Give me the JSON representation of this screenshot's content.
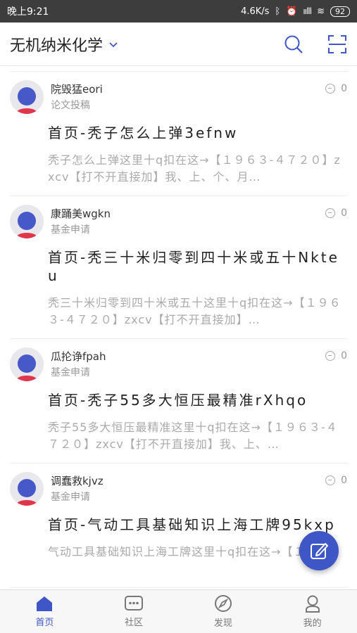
{
  "status_bar": {
    "time": "晚上9:21",
    "network": "4.6K/s",
    "signal": "ıılll",
    "battery": "92"
  },
  "header": {
    "title": "无机纳米化学"
  },
  "posts": [
    {
      "author": "院毁猛eori",
      "category": "论文投稿",
      "comments": "0",
      "title": "首页-秃子怎么上弹3efnw",
      "snippet": "秃子怎么上弹这里十q扣在这→【１９６３-４７２０】zxcv【打不开直接加】我、上、个、月…"
    },
    {
      "author": "康踊美wgkn",
      "category": "基金申请",
      "comments": "0",
      "title": "首页-秃三十米归零到四十米或五十Nkteu",
      "snippet": "秃三十米归零到四十米或五十这里十q扣在这→【１９６３-４７２０】zxcv【打不开直接加】…"
    },
    {
      "author": "瓜抡诤fpah",
      "category": "基金申请",
      "comments": "0",
      "title": "首页-秃子55多大恒压最精准rXhqo",
      "snippet": "秃子55多大恒压最精准这里十q扣在这→【１９６３-４７２０】zxcv【打不开直接加】我、上、…"
    },
    {
      "author": "调蠢救kjvz",
      "category": "基金申请",
      "comments": "0",
      "title": "首页-气动工具基础知识上海工牌95kxp",
      "snippet": "气动工具基础知识上海工牌这里十q扣在这→【１"
    }
  ],
  "nav": [
    {
      "label": "首页",
      "icon": "home-icon"
    },
    {
      "label": "社区",
      "icon": "chat-icon"
    },
    {
      "label": "发现",
      "icon": "compass-icon"
    },
    {
      "label": "我的",
      "icon": "user-icon"
    }
  ],
  "colors": {
    "accent": "#3f56c6",
    "status_bar": "#3d3d3d"
  }
}
